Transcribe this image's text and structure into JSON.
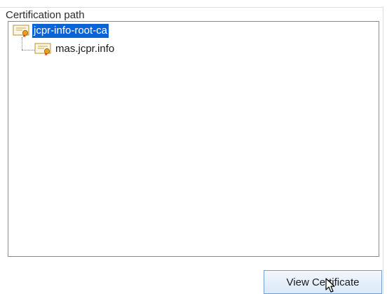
{
  "group": {
    "label": "Certification path"
  },
  "tree": {
    "nodes": [
      {
        "label": "jcpr-info-root-ca",
        "selected": true,
        "icon": "certificate-icon"
      },
      {
        "label": "mas.jcpr.info",
        "selected": false,
        "icon": "certificate-icon"
      }
    ]
  },
  "actions": {
    "view_certificate_label": "View Certificate"
  },
  "colors": {
    "selection": "#0a64d6",
    "button_border": "#6f9fd8"
  }
}
